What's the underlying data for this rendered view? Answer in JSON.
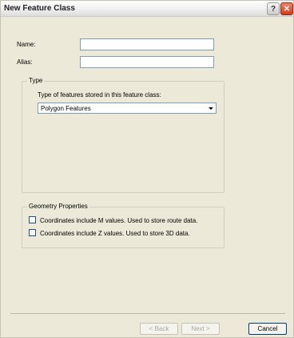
{
  "window": {
    "title": "New Feature Class",
    "help_glyph": "?",
    "close_glyph": "✕"
  },
  "form": {
    "name_label": "Name:",
    "name_value": "",
    "alias_label": "Alias:",
    "alias_value": ""
  },
  "type_group": {
    "title": "Type",
    "prompt": "Type of features stored in this feature class:",
    "selected": "Polygon Features"
  },
  "geometry": {
    "title": "Geometry Properties",
    "m_values_label": "Coordinates include M values. Used to store route data.",
    "m_values_checked": false,
    "z_values_label": "Coordinates include Z values. Used to store 3D data.",
    "z_values_checked": false
  },
  "buttons": {
    "back": "< Back",
    "next": "Next >",
    "cancel": "Cancel"
  }
}
